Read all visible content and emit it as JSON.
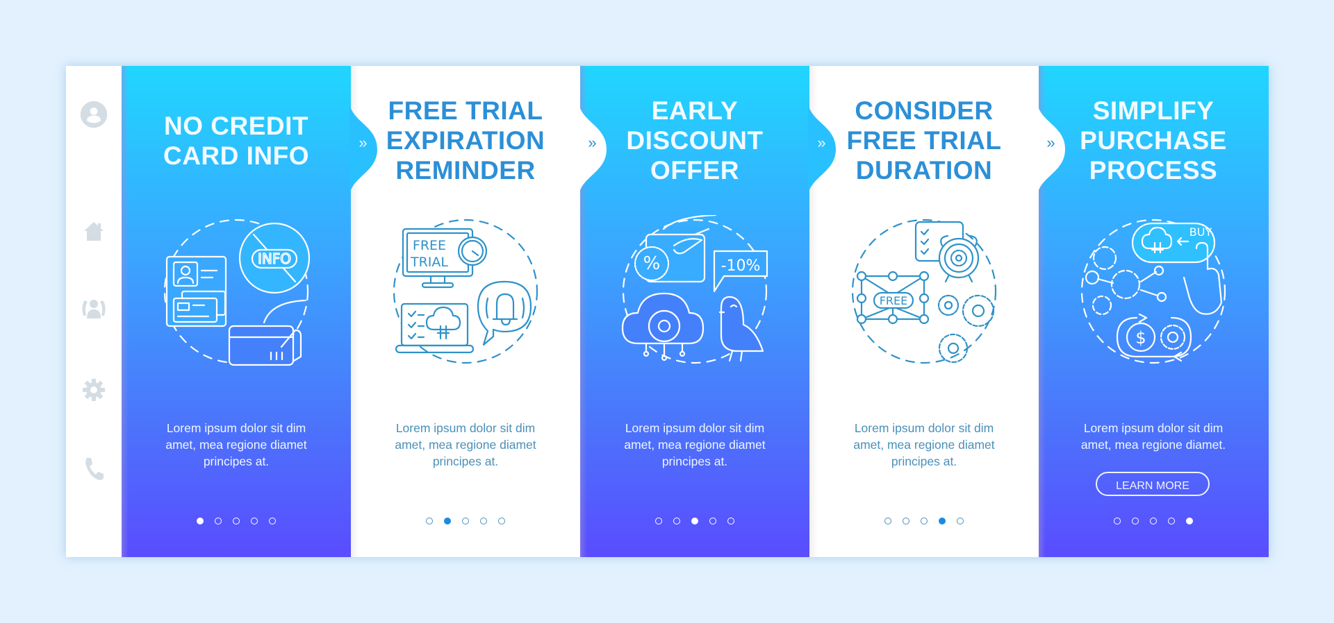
{
  "sidebar": {
    "items": [
      {
        "icon": "user-avatar-icon"
      },
      {
        "icon": "home-icon"
      },
      {
        "icon": "users-group-icon"
      },
      {
        "icon": "gear-icon"
      },
      {
        "icon": "phone-icon"
      }
    ]
  },
  "panels": [
    {
      "theme": "blue",
      "title_lines": [
        "NO CREDIT",
        "CARD  INFO"
      ],
      "icon": "no-credit-card-info-icon",
      "body": [
        "Lorem ipsum dolor sit dim",
        "amet, mea regione diamet",
        "principes at."
      ],
      "active_step": 1,
      "next_chevron": "»"
    },
    {
      "theme": "white",
      "title_lines": [
        "FREE TRIAL",
        "EXPIRATION",
        "REMINDER"
      ],
      "icon": "free-trial-reminder-icon",
      "icon_texts": [
        "FREE",
        "TRIAL"
      ],
      "body": [
        "Lorem ipsum dolor sit dim",
        "amet, mea regione diamet",
        "principes at."
      ],
      "active_step": 2,
      "next_chevron": "»"
    },
    {
      "theme": "blue",
      "title_lines": [
        "EARLY",
        "DISCOUNT",
        "OFFER"
      ],
      "icon": "early-discount-icon",
      "icon_texts": [
        "%",
        "-10%"
      ],
      "body": [
        "Lorem ipsum dolor sit dim",
        "amet, mea regione diamet",
        "principes at."
      ],
      "active_step": 3,
      "next_chevron": "»"
    },
    {
      "theme": "white",
      "title_lines": [
        "CONSIDER",
        "FREE TRIAL",
        "DURATION"
      ],
      "icon": "trial-duration-icon",
      "icon_texts": [
        "FREE"
      ],
      "body": [
        "Lorem ipsum dolor sit dim",
        "amet, mea regione diamet",
        "principes at."
      ],
      "active_step": 4,
      "next_chevron": "»"
    },
    {
      "theme": "blue",
      "title_lines": [
        "SIMPLIFY",
        "PURCHASE",
        "PROCESS"
      ],
      "icon": "simplify-purchase-icon",
      "icon_texts": [
        "BUY",
        "$"
      ],
      "body": [
        "Lorem ipsum dolor sit dim",
        "amet, mea regione diamet."
      ],
      "button_label": "LEARN MORE",
      "active_step": 5
    }
  ],
  "total_steps": 5,
  "colors": {
    "background": "#e2f1fd",
    "gradient_top": "#20d6ff",
    "gradient_bottom": "#5a4cff",
    "heading_on_white": "#2c8fd6",
    "body_on_white": "#4a90b8",
    "active_dot_on_white": "#1a8be0",
    "sidebar_icon": "#d3dde3"
  }
}
